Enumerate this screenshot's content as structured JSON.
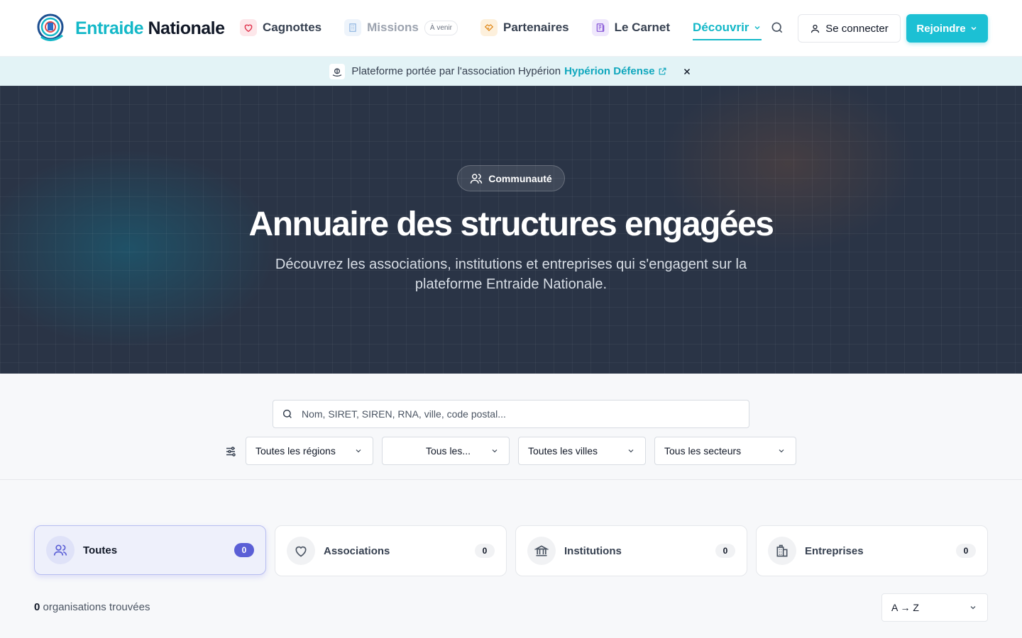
{
  "brand": {
    "name_part1": "Entraide",
    "name_part2": "Nationale",
    "accent_color": "#14b8c8"
  },
  "nav": {
    "items": [
      {
        "label": "Cagnottes",
        "icon": "heart-icon"
      },
      {
        "label": "Missions",
        "icon": "building-icon",
        "badge": "À venir",
        "disabled": true
      },
      {
        "label": "Partenaires",
        "icon": "handshake-icon"
      },
      {
        "label": "Le Carnet",
        "icon": "newspaper-icon"
      },
      {
        "label": "Découvrir",
        "icon": "chevron-down-icon",
        "active": true
      }
    ],
    "login_label": "Se connecter",
    "join_label": "Rejoindre"
  },
  "banner": {
    "text": "Plateforme portée par l'association Hypérion",
    "link": "Hypérion Défense"
  },
  "hero": {
    "pill": "Communauté",
    "title": "Annuaire des structures engagées",
    "subtitle": "Découvrez les associations, institutions et entreprises qui s'engagent sur la plateforme Entraide Nationale."
  },
  "search": {
    "placeholder": "Nom, SIRET, SIREN, RNA, ville, code postal...",
    "filters": [
      "Toutes les régions",
      "Tous les...",
      "Toutes les villes",
      "Tous les secteurs"
    ]
  },
  "categories": [
    {
      "label": "Toutes",
      "count": "0",
      "icon": "users-icon",
      "active": true
    },
    {
      "label": "Associations",
      "count": "0",
      "icon": "heart-icon"
    },
    {
      "label": "Institutions",
      "count": "0",
      "icon": "landmark-icon"
    },
    {
      "label": "Entreprises",
      "count": "0",
      "icon": "office-building-icon"
    }
  ],
  "results": {
    "count": "0",
    "label": "organisations trouvées"
  },
  "sort": {
    "value": "A → Z"
  }
}
